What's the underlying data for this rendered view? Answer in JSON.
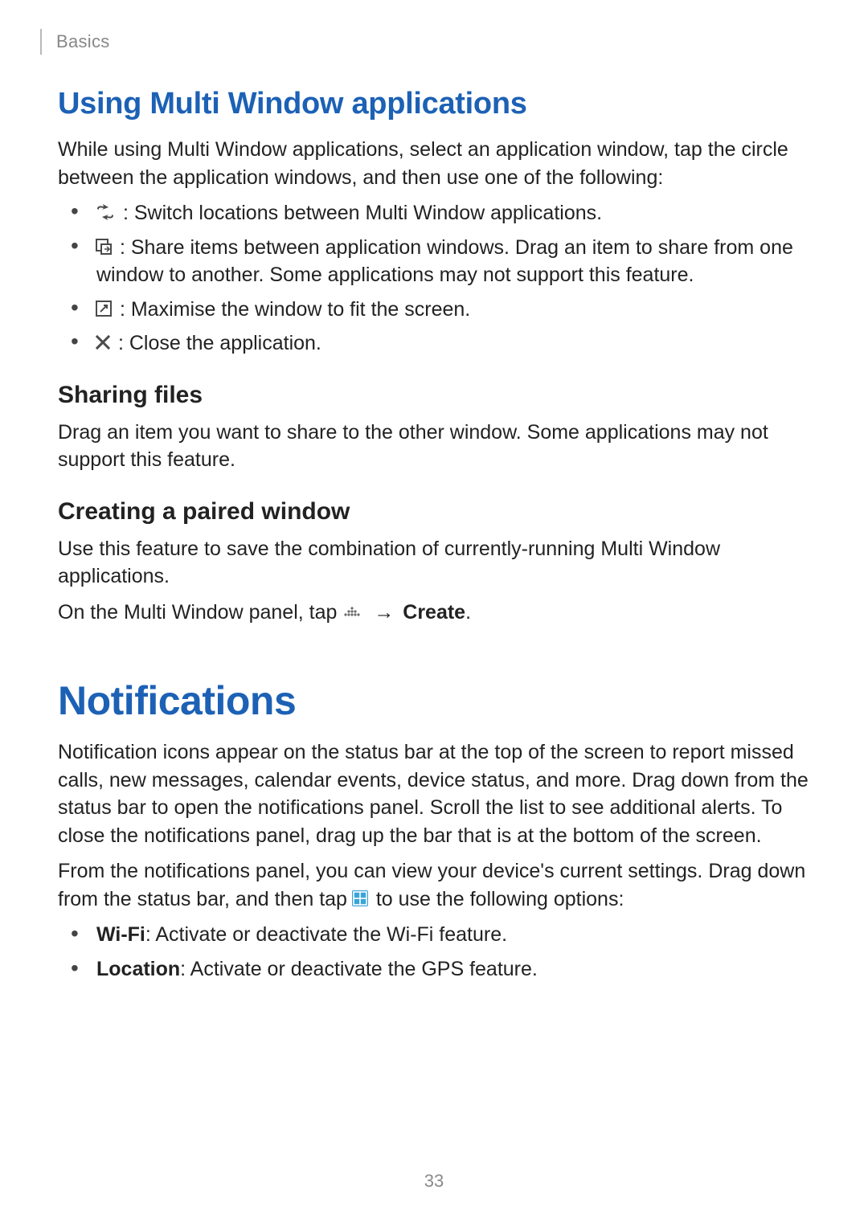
{
  "header": {
    "breadcrumb": "Basics"
  },
  "section1": {
    "title": "Using Multi Window applications",
    "intro": "While using Multi Window applications, select an application window, tap the circle between the application windows, and then use one of the following:",
    "items": [
      {
        "icon": "switch-icon",
        "text": ": Switch locations between Multi Window applications."
      },
      {
        "icon": "share-icon",
        "text": ": Share items between application windows. Drag an item to share from one window to another. Some applications may not support this feature."
      },
      {
        "icon": "maximise-icon",
        "text": ": Maximise the window to fit the screen."
      },
      {
        "icon": "close-icon",
        "text": ": Close the application."
      }
    ],
    "sub1": {
      "title": "Sharing files",
      "text": "Drag an item you want to share to the other window. Some applications may not support this feature."
    },
    "sub2": {
      "title": "Creating a paired window",
      "text1": "Use this feature to save the combination of currently-running Multi Window applications.",
      "text2a": "On the Multi Window panel, tap ",
      "text2b": "Create",
      "text2c": "."
    }
  },
  "section2": {
    "title": "Notifications",
    "para1": "Notification icons appear on the status bar at the top of the screen to report missed calls, new messages, calendar events, device status, and more. Drag down from the status bar to open the notifications panel. Scroll the list to see additional alerts. To close the notifications panel, drag up the bar that is at the bottom of the screen.",
    "para2a": "From the notifications panel, you can view your device's current settings. Drag down from the status bar, and then tap ",
    "para2b": " to use the following options:",
    "features": [
      {
        "label": "Wi-Fi",
        "text": ": Activate or deactivate the Wi-Fi feature."
      },
      {
        "label": "Location",
        "text": ": Activate or deactivate the GPS feature."
      }
    ]
  },
  "page_number": "33"
}
